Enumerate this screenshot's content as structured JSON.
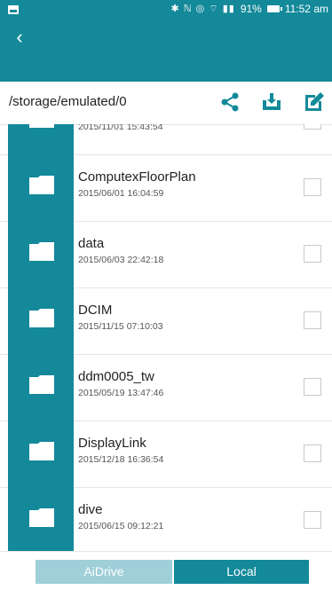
{
  "status": {
    "icons": "✱ ℕ ◎ ⌔ ▮▮",
    "battery": "91%",
    "time": "11:52 am"
  },
  "path": {
    "current": "/storage/emulated/0"
  },
  "items": [
    {
      "name": "",
      "date": "2015/11/01 15:43:54"
    },
    {
      "name": "ComputexFloorPlan",
      "date": "2015/06/01 16:04:59"
    },
    {
      "name": "data",
      "date": "2015/06/03 22:42:18"
    },
    {
      "name": "DCIM",
      "date": "2015/11/15 07:10:03"
    },
    {
      "name": "ddm0005_tw",
      "date": "2015/05/19 13:47:46"
    },
    {
      "name": "DisplayLink",
      "date": "2015/12/18 16:36:54"
    },
    {
      "name": "dive",
      "date": "2015/06/15 09:12:21"
    }
  ],
  "tabs": {
    "aidrive": "AiDrive",
    "local": "Local"
  },
  "colors": {
    "teal": "#13899a",
    "tab_inactive": "#9fcfd9"
  }
}
